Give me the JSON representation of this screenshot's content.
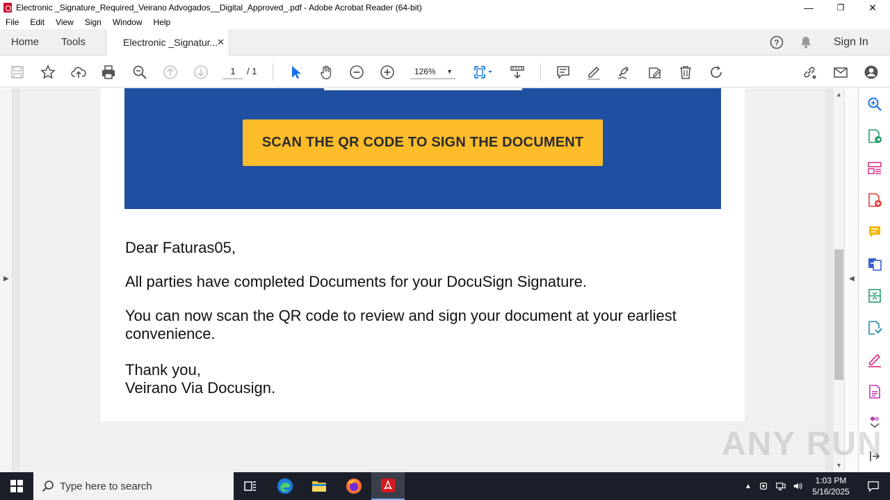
{
  "window": {
    "title": "Electronic _Signature_Required_Veirano Advogados__Digital_Approved_.pdf - Adobe Acrobat Reader (64-bit)",
    "minimize": "—",
    "restore": "❐",
    "close": "✕"
  },
  "menu": [
    "File",
    "Edit",
    "View",
    "Sign",
    "Window",
    "Help"
  ],
  "tabs": {
    "home": "Home",
    "tools": "Tools",
    "document": "Electronic _Signatur...",
    "close": "✕",
    "signin": "Sign In"
  },
  "toolbar": {
    "page_current": "1",
    "page_total": "/ 1",
    "zoom": "126%"
  },
  "document": {
    "cta": "SCAN THE QR CODE TO SIGN THE DOCUMENT",
    "greeting": "Dear Faturas05,",
    "line1": "All parties have completed Documents for your DocuSign Signature.",
    "line2a": "You can now scan the QR code to review and sign your document at your earliest",
    "line2b": "convenience.",
    "closing1": "Thank you,",
    "closing2": "Veirano Via Docusign."
  },
  "colors": {
    "blue_banner": "#1f4fa0",
    "cta_yellow": "#fdbd2a",
    "acrobat_red": "#c8102e",
    "icon_blue": "#1473e6"
  },
  "watermark": "ANY RUN",
  "taskbar": {
    "search_placeholder": "Type here to search",
    "time": "1:03 PM",
    "date": "5/16/2025"
  }
}
